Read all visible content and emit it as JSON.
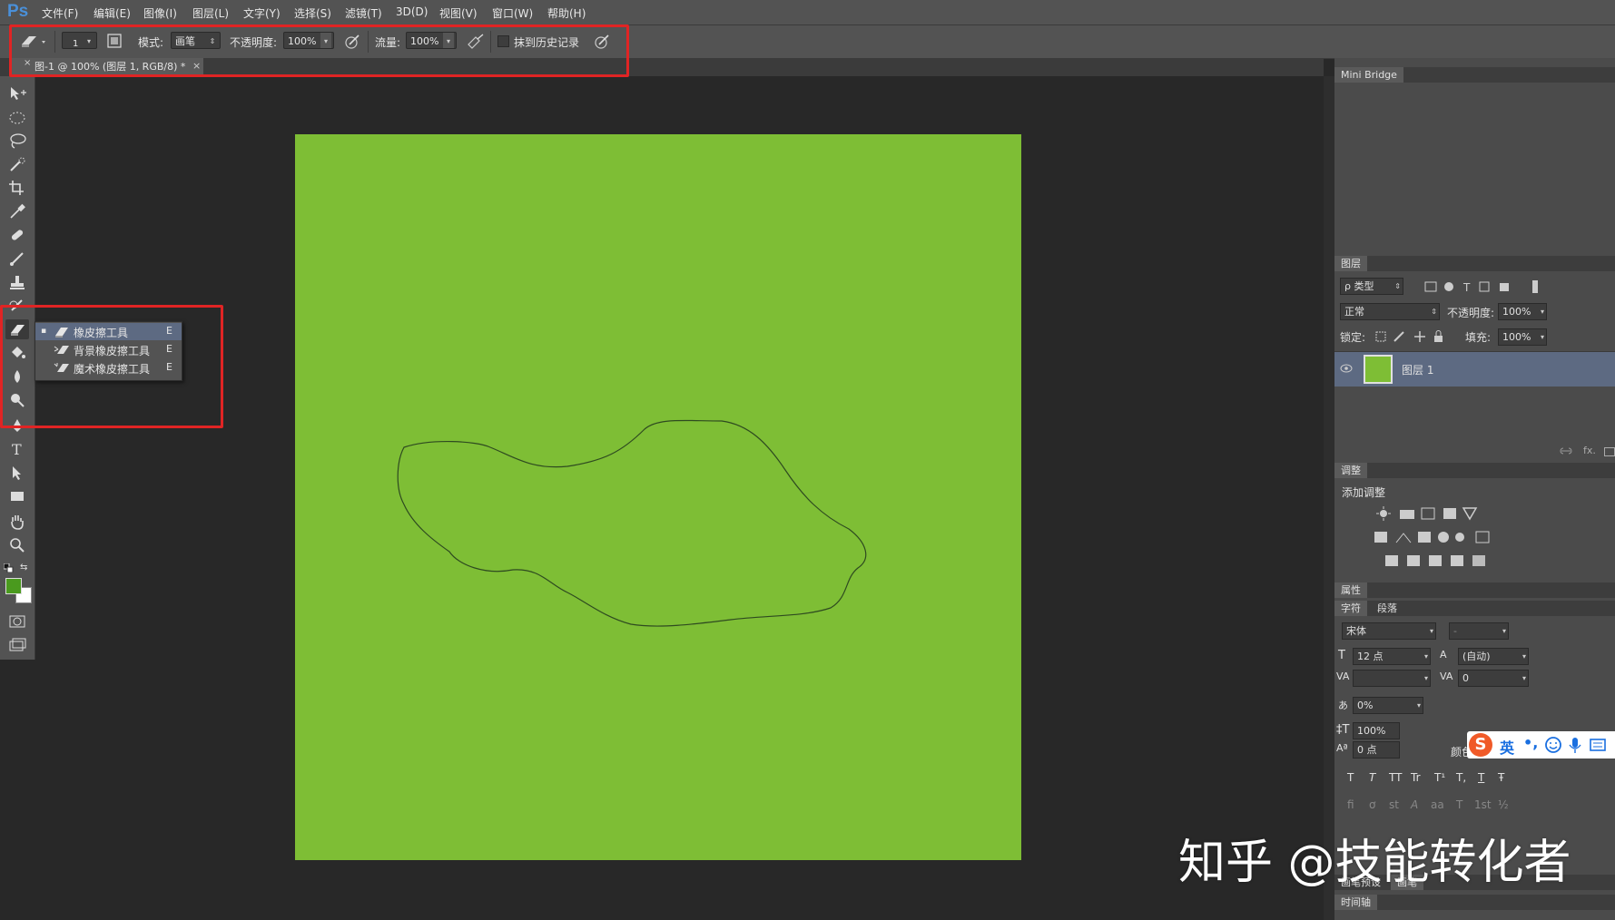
{
  "app": {
    "logo": "Ps"
  },
  "menu": [
    "文件(F)",
    "编辑(E)",
    "图像(I)",
    "图层(L)",
    "文字(Y)",
    "选择(S)",
    "滤镜(T)",
    "3D(D)",
    "视图(V)",
    "窗口(W)",
    "帮助(H)"
  ],
  "options": {
    "brush_size": "1",
    "mode_label": "模式:",
    "mode_value": "画笔",
    "opacity_label": "不透明度:",
    "opacity_value": "100%",
    "flow_label": "流量:",
    "flow_value": "100%",
    "erase_history_label": "抹到历史记录",
    "erase_history_checked": false
  },
  "document": {
    "tab_title": "图-1 @ 100% (图层 1, RGB/8) *",
    "close_glyph": "×",
    "canvas_color": "#7ebe35"
  },
  "flyout": {
    "items": [
      {
        "label": "橡皮擦工具",
        "key": "E",
        "selected": true,
        "bullet": "▪"
      },
      {
        "label": "背景橡皮擦工具",
        "key": "E",
        "selected": false,
        "bullet": ""
      },
      {
        "label": "魔术橡皮擦工具",
        "key": "E",
        "selected": false,
        "bullet": ""
      }
    ]
  },
  "tools": [
    "move-tool-icon",
    "marquee-tool-icon",
    "lasso-tool-icon",
    "quick-select-tool-icon",
    "crop-tool-icon",
    "eyedropper-tool-icon",
    "healing-brush-tool-icon",
    "brush-tool-icon",
    "clone-stamp-tool-icon",
    "history-brush-tool-icon",
    "eraser-tool-icon",
    "paint-bucket-tool-icon",
    "blur-tool-icon",
    "dodge-tool-icon",
    "pen-tool-icon",
    "type-tool-icon",
    "path-select-tool-icon",
    "rectangle-tool-icon",
    "hand-tool-icon",
    "zoom-tool-icon"
  ],
  "colors": {
    "foreground": "#4a9a1e",
    "background": "#ffffff",
    "highlight": "#e02424"
  },
  "panels": {
    "mini_bridge": {
      "tab": "Mini Bridge"
    },
    "layers": {
      "tab": "图层",
      "filter_label": "ρ 类型",
      "blend_mode": "正常",
      "opacity_label": "不透明度:",
      "opacity_value": "100%",
      "lock_label": "锁定:",
      "fill_label": "填充:",
      "fill_value": "100%",
      "layer_name": "图层 1",
      "fx_label": "fx."
    },
    "adjustments": {
      "tab": "调整",
      "add_label": "添加调整"
    },
    "properties": {
      "tab": "属性"
    },
    "character": {
      "tab_char": "字符",
      "tab_para": "段落",
      "font_family": "宋体",
      "font_style": "-",
      "font_size": "12 点",
      "leading": "(自动)",
      "kerning": "",
      "tracking": "0",
      "tsume": "0%",
      "vscale": "100%",
      "baseline": "0 点",
      "color_label": "颜色:",
      "type_buttons": [
        "T",
        "T",
        "TT",
        "Tr",
        "T¹",
        "T,",
        "T",
        "Ŧ"
      ],
      "opentype_buttons": [
        "fi",
        "ơ",
        "st",
        "A",
        "aa",
        "T",
        "1st",
        "½"
      ]
    },
    "bottom_tabs": {
      "brush_preset": "画笔预设",
      "brush": "画笔",
      "timeline": "时间轴"
    }
  },
  "ime": {
    "lang": "英",
    "punct": "•,"
  },
  "watermark": "知乎 @技能转化者"
}
